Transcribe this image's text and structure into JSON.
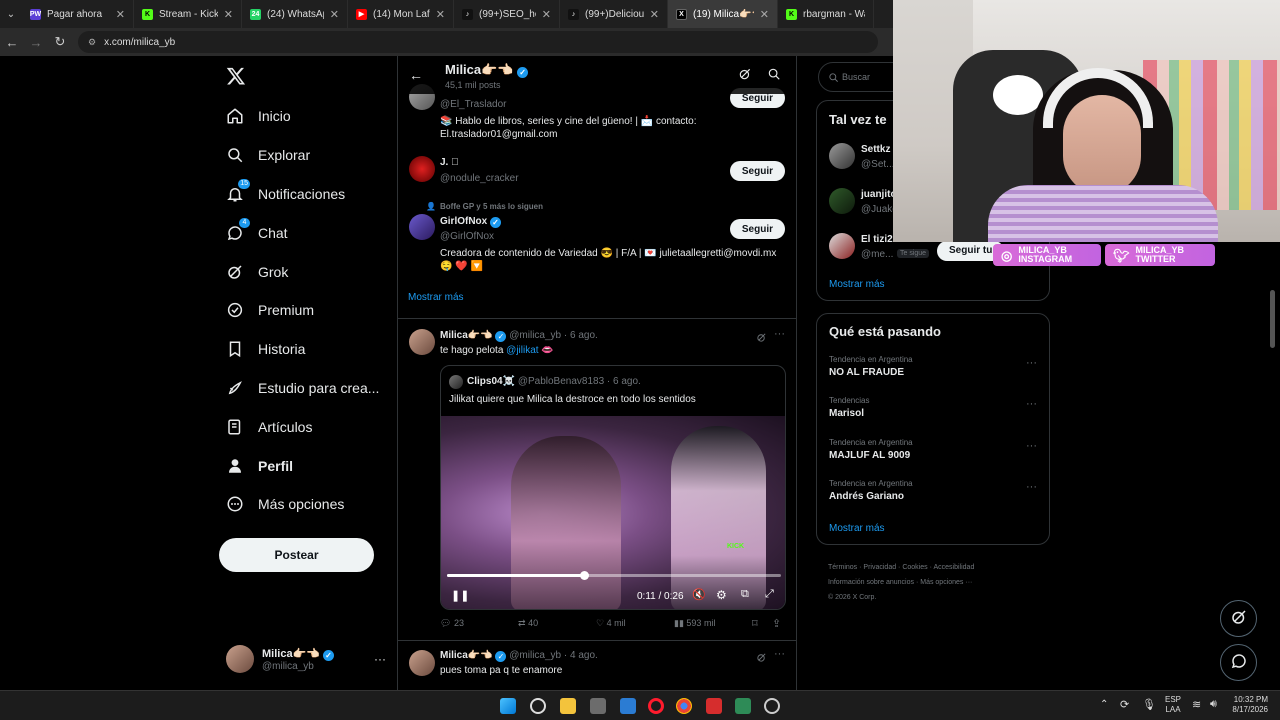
{
  "browser": {
    "tabs": [
      {
        "label": "Pagar ahora",
        "icon": "pw-icon",
        "color": "#5b3fd6",
        "letter": "PW"
      },
      {
        "label": "Stream - Kick Dash",
        "icon": "kick-icon",
        "color": "#53fc18",
        "letter": "K"
      },
      {
        "label": "(24) WhatsApp",
        "icon": "whatsapp-icon",
        "color": "#25d366",
        "letter": "24"
      },
      {
        "label": "(14) Mon Laferte",
        "icon": "youtube-icon",
        "color": "#ff0000",
        "letter": "▶"
      },
      {
        "label": "(99+)SEO_homep",
        "icon": "tiktok-icon",
        "color": "#111111",
        "letter": "♪"
      },
      {
        "label": "(99+)Deliciously",
        "icon": "tiktok-icon",
        "color": "#111111",
        "letter": "♪"
      },
      {
        "label": "(19) Milica👉🏻👈🏻",
        "icon": "x-icon",
        "color": "#000000",
        "letter": "X"
      },
      {
        "label": "rbargman - Watc",
        "icon": "kick-icon",
        "color": "#53fc18",
        "letter": "K"
      }
    ],
    "url": "x.com/milica_yb"
  },
  "nav": {
    "items": [
      {
        "label": "Inicio",
        "icon": "home-icon"
      },
      {
        "label": "Explorar",
        "icon": "search-icon"
      },
      {
        "label": "Notificaciones",
        "icon": "bell-icon",
        "badge": "15"
      },
      {
        "label": "Chat",
        "icon": "chat-icon",
        "badge": "4"
      },
      {
        "label": "Grok",
        "icon": "grok-icon"
      },
      {
        "label": "Premium",
        "icon": "premium-icon"
      },
      {
        "label": "Historia",
        "icon": "bookmark-icon"
      },
      {
        "label": "Estudio para crea...",
        "icon": "rocket-icon"
      },
      {
        "label": "Artículos",
        "icon": "article-icon"
      },
      {
        "label": "Perfil",
        "icon": "person-icon"
      },
      {
        "label": "Más opciones",
        "icon": "more-circle-icon"
      }
    ],
    "post_button": "Postear",
    "account": {
      "name": "Milica👉🏻👈🏻",
      "handle": "@milica_yb"
    }
  },
  "profile_header": {
    "name": "Milica👉🏻👈🏻",
    "posts": "45,1 mil posts"
  },
  "suggestions": {
    "follow_label": "Seguir",
    "items": [
      {
        "handle": "@El_Traslador",
        "bio": "📚 Hablo de libros, series y cine del güeno! | 📩 contacto: El.traslador01@gmail.com"
      },
      {
        "name": "J. ⃞",
        "handle": "@nodule_cracker"
      },
      {
        "followed_by": "Boffe GP y 5 más lo siguen",
        "name": "GirlOfNox",
        "handle": "@GirlOfNox",
        "bio": "Creadora de contenido de Variedad 😎 | F/A | 💌 julietaallegretti@movdi.mx",
        "bio2": "🤤 ❤️ 🔽"
      }
    ],
    "show_more": "Mostrar más"
  },
  "post": {
    "author": "Milica👉🏻👈🏻",
    "handle": "@milica_yb",
    "date": "· 6 ago.",
    "text": "te hago pelota",
    "mention": "@jilikat",
    "emoji": "👄",
    "quote": {
      "author": "Clips04☠️",
      "handle": "@PabloBenav8183",
      "date": "· 6 ago.",
      "text": "Jilikat quiere que Milica la destroce en todo los sentidos",
      "video_time": "0:11 / 0:26",
      "progress": 0.41
    },
    "stats": {
      "replies": "23",
      "reposts": "40",
      "likes": "4 mil",
      "views": "593 mil"
    }
  },
  "post2": {
    "author": "Milica👉🏻👈🏻",
    "handle": "@milica_yb",
    "date": "· 4 ago.",
    "text": "pues toma pa q te enamore"
  },
  "right": {
    "search_placeholder": "Buscar",
    "who_to_follow_title": "Tal vez te",
    "follow_items": [
      {
        "name": "Settkz",
        "handle": "@Set..."
      },
      {
        "name": "juanjito",
        "handle": "@Juako"
      },
      {
        "name": "El tizi2",
        "handle": "@me...",
        "tag": "Te sigue",
        "button": "Seguir tu"
      }
    ],
    "show_more_1": "Mostrar más",
    "trending_title": "Qué está pasando",
    "trends": [
      {
        "category": "Tendencia en Argentina",
        "name": "NO AL FRAUDE"
      },
      {
        "category": "Tendencias",
        "name": "Marisol"
      },
      {
        "category": "Tendencia en Argentina",
        "name": "MAJLUF AL 9009"
      },
      {
        "category": "Tendencia en Argentina",
        "name": "Andrés Gariano"
      }
    ],
    "show_more_2": "Mostrar más",
    "footer": [
      "Términos",
      "Privacidad",
      "Cookies",
      "Accesibilidad",
      "Información sobre anuncios",
      "Más opciones ···",
      "© 2026 X Corp."
    ]
  },
  "overlay": {
    "instagram": {
      "handle": "MILICA_YB",
      "label": "INSTAGRAM"
    },
    "twitter": {
      "handle": "MILICA_YB",
      "label": "TWITTER"
    }
  },
  "taskbar": {
    "lang": "ESP",
    "layout": "LAA",
    "time": "10:32 PM",
    "date": "8/17/2026"
  }
}
